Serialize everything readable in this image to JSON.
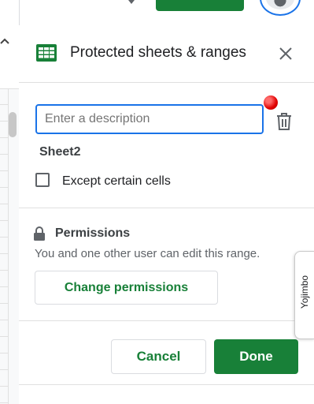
{
  "panel": {
    "title": "Protected sheets & ranges"
  },
  "description": {
    "placeholder": "Enter a description",
    "value": ""
  },
  "range": {
    "sheet_name": "Sheet2"
  },
  "except_cells": {
    "label": "Except certain cells",
    "checked": false
  },
  "permissions": {
    "heading": "Permissions",
    "description": "You and one other user can edit this range.",
    "change_button": "Change permissions"
  },
  "actions": {
    "cancel": "Cancel",
    "done": "Done"
  },
  "side_tab": {
    "label": "Yojimbo"
  },
  "icons": {
    "header": "sheets-icon",
    "close": "close-icon",
    "delete": "trash-icon",
    "permissions": "lock-icon",
    "notification": "red-dot"
  },
  "colors": {
    "accent_green": "#188038",
    "focus_blue": "#1a73e8",
    "notification_red": "#e00000"
  }
}
